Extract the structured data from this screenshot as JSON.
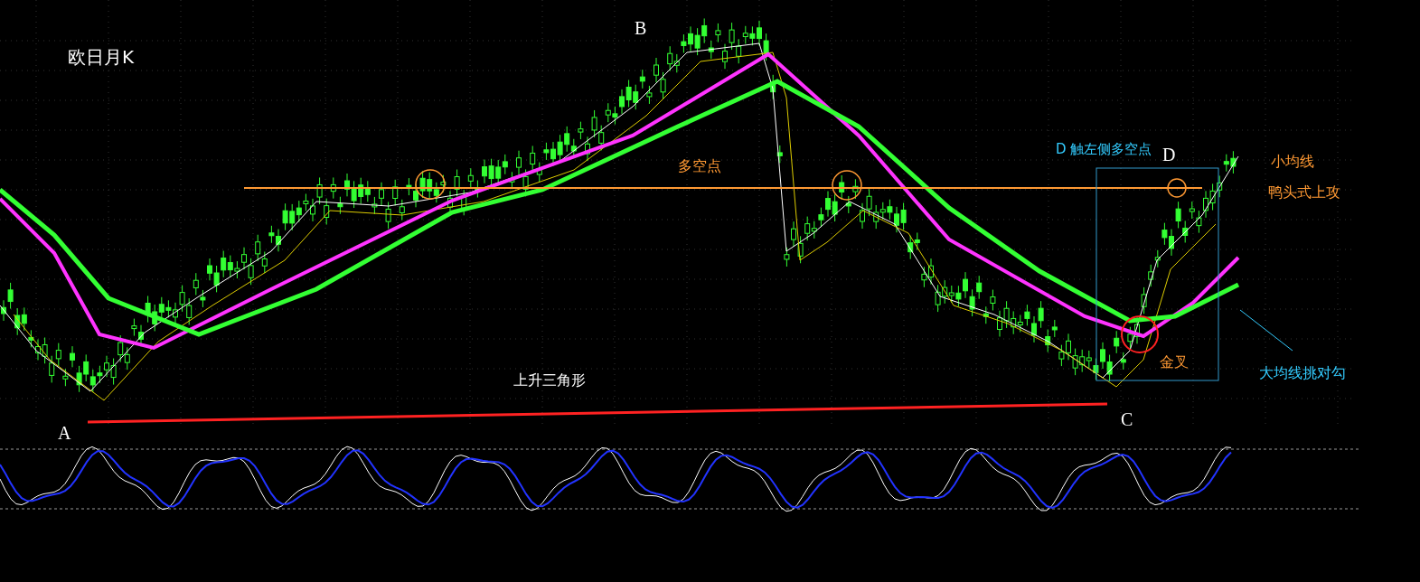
{
  "chart_title": "欧日月K",
  "point_labels": [
    {
      "kind": "a",
      "text": "A"
    },
    {
      "kind": "b",
      "text": "B"
    },
    {
      "kind": "c",
      "text": "C"
    },
    {
      "kind": "d",
      "text": "D"
    }
  ],
  "annotations": [
    {
      "kind": "resistance",
      "text": "多空点"
    },
    {
      "kind": "touch",
      "text": "D 触左侧多空点"
    },
    {
      "kind": "small_ma",
      "text": "小均线"
    },
    {
      "kind": "duck_head",
      "text": "鸭头式上攻"
    },
    {
      "kind": "big_ma",
      "text": "大均线挑对勾"
    },
    {
      "kind": "golden_cross",
      "text": "金叉"
    },
    {
      "kind": "triangle",
      "text": "上升三角形"
    }
  ]
}
